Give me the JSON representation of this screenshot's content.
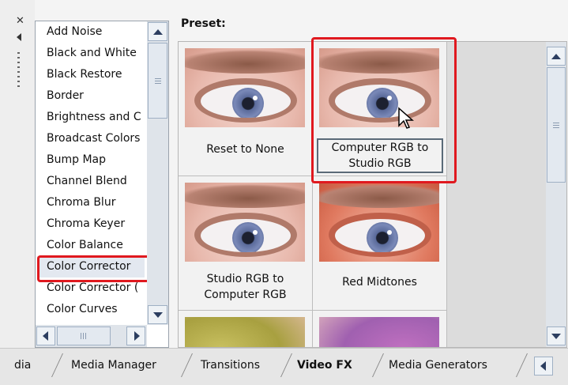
{
  "effects_list": {
    "items": [
      "Add Noise",
      "Black and White",
      "Black Restore",
      "Border",
      "Brightness and C",
      "Broadcast Colors",
      "Bump Map",
      "Channel Blend",
      "Chroma Blur",
      "Chroma Keyer",
      "Color Balance",
      "Color Corrector",
      "Color Corrector (",
      "Color Curves"
    ],
    "selected_index": 11
  },
  "preset": {
    "label": "Preset:",
    "tiles": [
      {
        "caption_line1": "Reset to None",
        "caption_line2": ""
      },
      {
        "caption_line1": "Computer RGB to",
        "caption_line2": "Studio RGB"
      },
      {
        "caption_line1": "Studio RGB to",
        "caption_line2": "Computer RGB"
      },
      {
        "caption_line1": "Red Midtones",
        "caption_line2": ""
      }
    ]
  },
  "tabs": {
    "items": [
      "dia",
      "Media Manager",
      "Transitions",
      "Video FX",
      "Media Generators"
    ],
    "active": "Video FX"
  },
  "colors": {
    "highlight_red": "#e0191f",
    "scroll_arrow": "#2c3e60"
  },
  "icons": {
    "close": "close-icon",
    "collapse": "collapse-left-icon",
    "grip": "dock-grip-icon",
    "cursor": "mouse-pointer-icon"
  }
}
